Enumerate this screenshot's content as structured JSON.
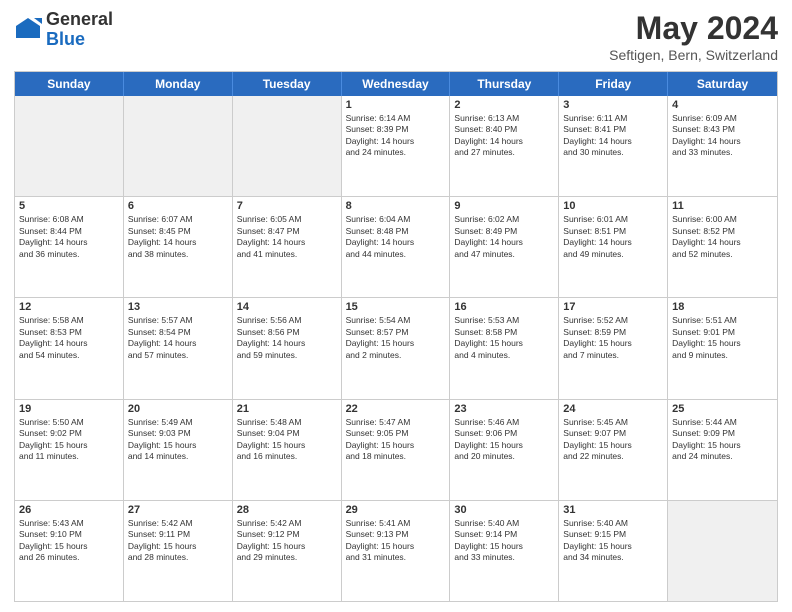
{
  "logo": {
    "general": "General",
    "blue": "Blue"
  },
  "header": {
    "month_title": "May 2024",
    "location": "Seftigen, Bern, Switzerland"
  },
  "weekdays": [
    "Sunday",
    "Monday",
    "Tuesday",
    "Wednesday",
    "Thursday",
    "Friday",
    "Saturday"
  ],
  "rows": [
    [
      {
        "day": "",
        "text": "",
        "shaded": true
      },
      {
        "day": "",
        "text": "",
        "shaded": true
      },
      {
        "day": "",
        "text": "",
        "shaded": true
      },
      {
        "day": "1",
        "text": "Sunrise: 6:14 AM\nSunset: 8:39 PM\nDaylight: 14 hours\nand 24 minutes.",
        "shaded": false
      },
      {
        "day": "2",
        "text": "Sunrise: 6:13 AM\nSunset: 8:40 PM\nDaylight: 14 hours\nand 27 minutes.",
        "shaded": false
      },
      {
        "day": "3",
        "text": "Sunrise: 6:11 AM\nSunset: 8:41 PM\nDaylight: 14 hours\nand 30 minutes.",
        "shaded": false
      },
      {
        "day": "4",
        "text": "Sunrise: 6:09 AM\nSunset: 8:43 PM\nDaylight: 14 hours\nand 33 minutes.",
        "shaded": false
      }
    ],
    [
      {
        "day": "5",
        "text": "Sunrise: 6:08 AM\nSunset: 8:44 PM\nDaylight: 14 hours\nand 36 minutes.",
        "shaded": false
      },
      {
        "day": "6",
        "text": "Sunrise: 6:07 AM\nSunset: 8:45 PM\nDaylight: 14 hours\nand 38 minutes.",
        "shaded": false
      },
      {
        "day": "7",
        "text": "Sunrise: 6:05 AM\nSunset: 8:47 PM\nDaylight: 14 hours\nand 41 minutes.",
        "shaded": false
      },
      {
        "day": "8",
        "text": "Sunrise: 6:04 AM\nSunset: 8:48 PM\nDaylight: 14 hours\nand 44 minutes.",
        "shaded": false
      },
      {
        "day": "9",
        "text": "Sunrise: 6:02 AM\nSunset: 8:49 PM\nDaylight: 14 hours\nand 47 minutes.",
        "shaded": false
      },
      {
        "day": "10",
        "text": "Sunrise: 6:01 AM\nSunset: 8:51 PM\nDaylight: 14 hours\nand 49 minutes.",
        "shaded": false
      },
      {
        "day": "11",
        "text": "Sunrise: 6:00 AM\nSunset: 8:52 PM\nDaylight: 14 hours\nand 52 minutes.",
        "shaded": false
      }
    ],
    [
      {
        "day": "12",
        "text": "Sunrise: 5:58 AM\nSunset: 8:53 PM\nDaylight: 14 hours\nand 54 minutes.",
        "shaded": false
      },
      {
        "day": "13",
        "text": "Sunrise: 5:57 AM\nSunset: 8:54 PM\nDaylight: 14 hours\nand 57 minutes.",
        "shaded": false
      },
      {
        "day": "14",
        "text": "Sunrise: 5:56 AM\nSunset: 8:56 PM\nDaylight: 14 hours\nand 59 minutes.",
        "shaded": false
      },
      {
        "day": "15",
        "text": "Sunrise: 5:54 AM\nSunset: 8:57 PM\nDaylight: 15 hours\nand 2 minutes.",
        "shaded": false
      },
      {
        "day": "16",
        "text": "Sunrise: 5:53 AM\nSunset: 8:58 PM\nDaylight: 15 hours\nand 4 minutes.",
        "shaded": false
      },
      {
        "day": "17",
        "text": "Sunrise: 5:52 AM\nSunset: 8:59 PM\nDaylight: 15 hours\nand 7 minutes.",
        "shaded": false
      },
      {
        "day": "18",
        "text": "Sunrise: 5:51 AM\nSunset: 9:01 PM\nDaylight: 15 hours\nand 9 minutes.",
        "shaded": false
      }
    ],
    [
      {
        "day": "19",
        "text": "Sunrise: 5:50 AM\nSunset: 9:02 PM\nDaylight: 15 hours\nand 11 minutes.",
        "shaded": false
      },
      {
        "day": "20",
        "text": "Sunrise: 5:49 AM\nSunset: 9:03 PM\nDaylight: 15 hours\nand 14 minutes.",
        "shaded": false
      },
      {
        "day": "21",
        "text": "Sunrise: 5:48 AM\nSunset: 9:04 PM\nDaylight: 15 hours\nand 16 minutes.",
        "shaded": false
      },
      {
        "day": "22",
        "text": "Sunrise: 5:47 AM\nSunset: 9:05 PM\nDaylight: 15 hours\nand 18 minutes.",
        "shaded": false
      },
      {
        "day": "23",
        "text": "Sunrise: 5:46 AM\nSunset: 9:06 PM\nDaylight: 15 hours\nand 20 minutes.",
        "shaded": false
      },
      {
        "day": "24",
        "text": "Sunrise: 5:45 AM\nSunset: 9:07 PM\nDaylight: 15 hours\nand 22 minutes.",
        "shaded": false
      },
      {
        "day": "25",
        "text": "Sunrise: 5:44 AM\nSunset: 9:09 PM\nDaylight: 15 hours\nand 24 minutes.",
        "shaded": false
      }
    ],
    [
      {
        "day": "26",
        "text": "Sunrise: 5:43 AM\nSunset: 9:10 PM\nDaylight: 15 hours\nand 26 minutes.",
        "shaded": false
      },
      {
        "day": "27",
        "text": "Sunrise: 5:42 AM\nSunset: 9:11 PM\nDaylight: 15 hours\nand 28 minutes.",
        "shaded": false
      },
      {
        "day": "28",
        "text": "Sunrise: 5:42 AM\nSunset: 9:12 PM\nDaylight: 15 hours\nand 29 minutes.",
        "shaded": false
      },
      {
        "day": "29",
        "text": "Sunrise: 5:41 AM\nSunset: 9:13 PM\nDaylight: 15 hours\nand 31 minutes.",
        "shaded": false
      },
      {
        "day": "30",
        "text": "Sunrise: 5:40 AM\nSunset: 9:14 PM\nDaylight: 15 hours\nand 33 minutes.",
        "shaded": false
      },
      {
        "day": "31",
        "text": "Sunrise: 5:40 AM\nSunset: 9:15 PM\nDaylight: 15 hours\nand 34 minutes.",
        "shaded": false
      },
      {
        "day": "",
        "text": "",
        "shaded": true
      }
    ]
  ]
}
